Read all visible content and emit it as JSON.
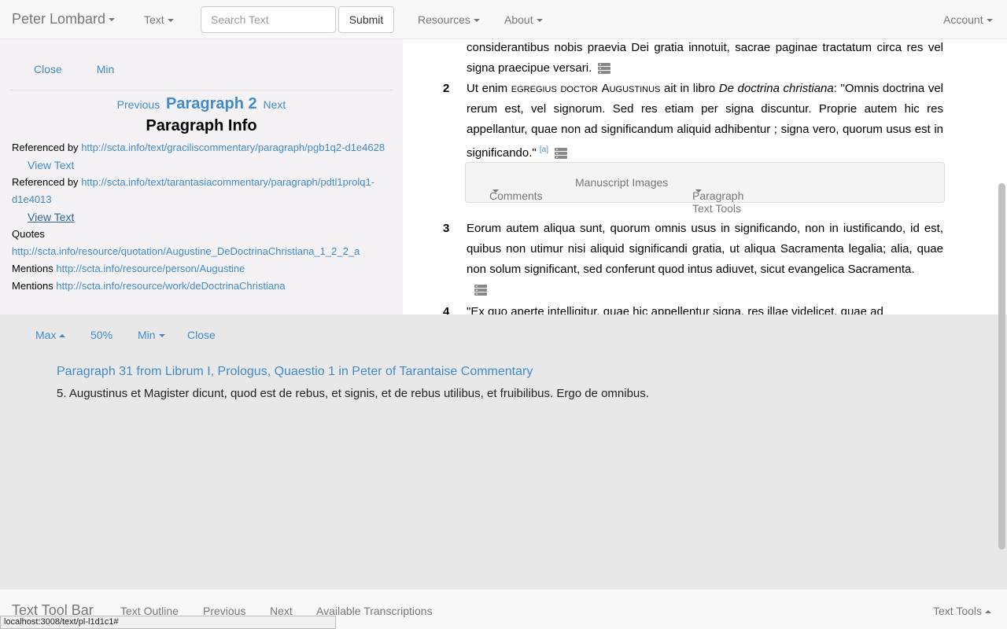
{
  "navbar": {
    "brand": "Peter Lombard",
    "text_menu": "Text",
    "search_placeholder": "Search Text",
    "submit_label": "Submit",
    "resources_menu": "Resources",
    "about_menu": "About",
    "account_menu": "Account"
  },
  "left_panel": {
    "close_label": "Close",
    "min_label": "Min",
    "previous_label": "Previous",
    "paragraph_label": "Paragraph 2",
    "next_label": "Next",
    "info_title": "Paragraph Info",
    "referenced_by_label": "Referenced by",
    "ref1_url": "http://scta.info/text/graciliscommentary/paragraph/pgb1q2-d1e4628",
    "view_text_label": "View Text",
    "ref2_url": "http://scta.info/text/tarantasiacommentary/paragraph/pdtl1prolq1-d1e4013",
    "quotes_label": "Quotes",
    "quote_url": "http://scta.info/resource/quotation/Augustine_DeDoctrinaChristiana_1_2_2_a",
    "mentions_label": "Mentions",
    "mention1_url": "http://scta.info/resource/person/Augustine",
    "mention2_url": "http://scta.info/resource/work/deDoctrinaChristiana"
  },
  "right_panel": {
    "p1_text": "considerantibus nobis praevia Dei gratia innotuit, sacrae paginae tractatum circa res vel signa praecipue versari.",
    "p2_num": "2",
    "p2_pre": "Ut enim ",
    "p2_sc1": "egregius doctor",
    "p2_sc2": "Augustinus",
    "p2_mid": " ait in libro ",
    "p2_italic": "De doctrina christiana",
    "p2_post": ": \"Omnis doctrina vel rerum est, vel signorum. Sed res etiam per signa discuntur. Proprie autem hic res appellantur, quae non ad significandum aliquid adhibentur ; signa vero, quorum usus est in significando.\"",
    "p2_fn": "[a]",
    "tools": {
      "comments": "Comments",
      "manuscript_images": "Manuscript Images",
      "paragraph_text_tools": "Paragraph Text Tools"
    },
    "p3_num": "3",
    "p3_text": "Eorum autem aliqua sunt, quorum omnis usus in significando, non in iustificando, id est, quibus non utimur nisi aliquid significandi gratia, ut aliqua Sacramenta legalia; alia, quae non solum significant, sed conferunt quod intus adiuvet, sicut evangelica Sacramenta.",
    "p4_num": "4",
    "p4_text": "\"Ex quo aperte intelligitur, quae hic appellentur signa, res illae videlicet, quae ad"
  },
  "bottom_panel": {
    "max_label": "Max",
    "half_label": "50%",
    "min_label": "Min",
    "close_label": "Close",
    "link_text": "Paragraph 31 from Librum I, Prologus, Quaestio 1 in Peter of Tarantaise Commentary",
    "body_text": "5. Augustinus et Magister dicunt, quod est de rebus, et signis, et de rebus utilibus, et fruibilibus. Ergo de omnibus."
  },
  "footer": {
    "brand": "Text Tool Bar",
    "text_outline": "Text Outline",
    "previous": "Previous",
    "next": "Next",
    "available_transcriptions": "Available Transcriptions",
    "text_tools": "Text Tools"
  },
  "status_bar": {
    "url": "localhost:3008/text/pl-l1d1c1#"
  }
}
